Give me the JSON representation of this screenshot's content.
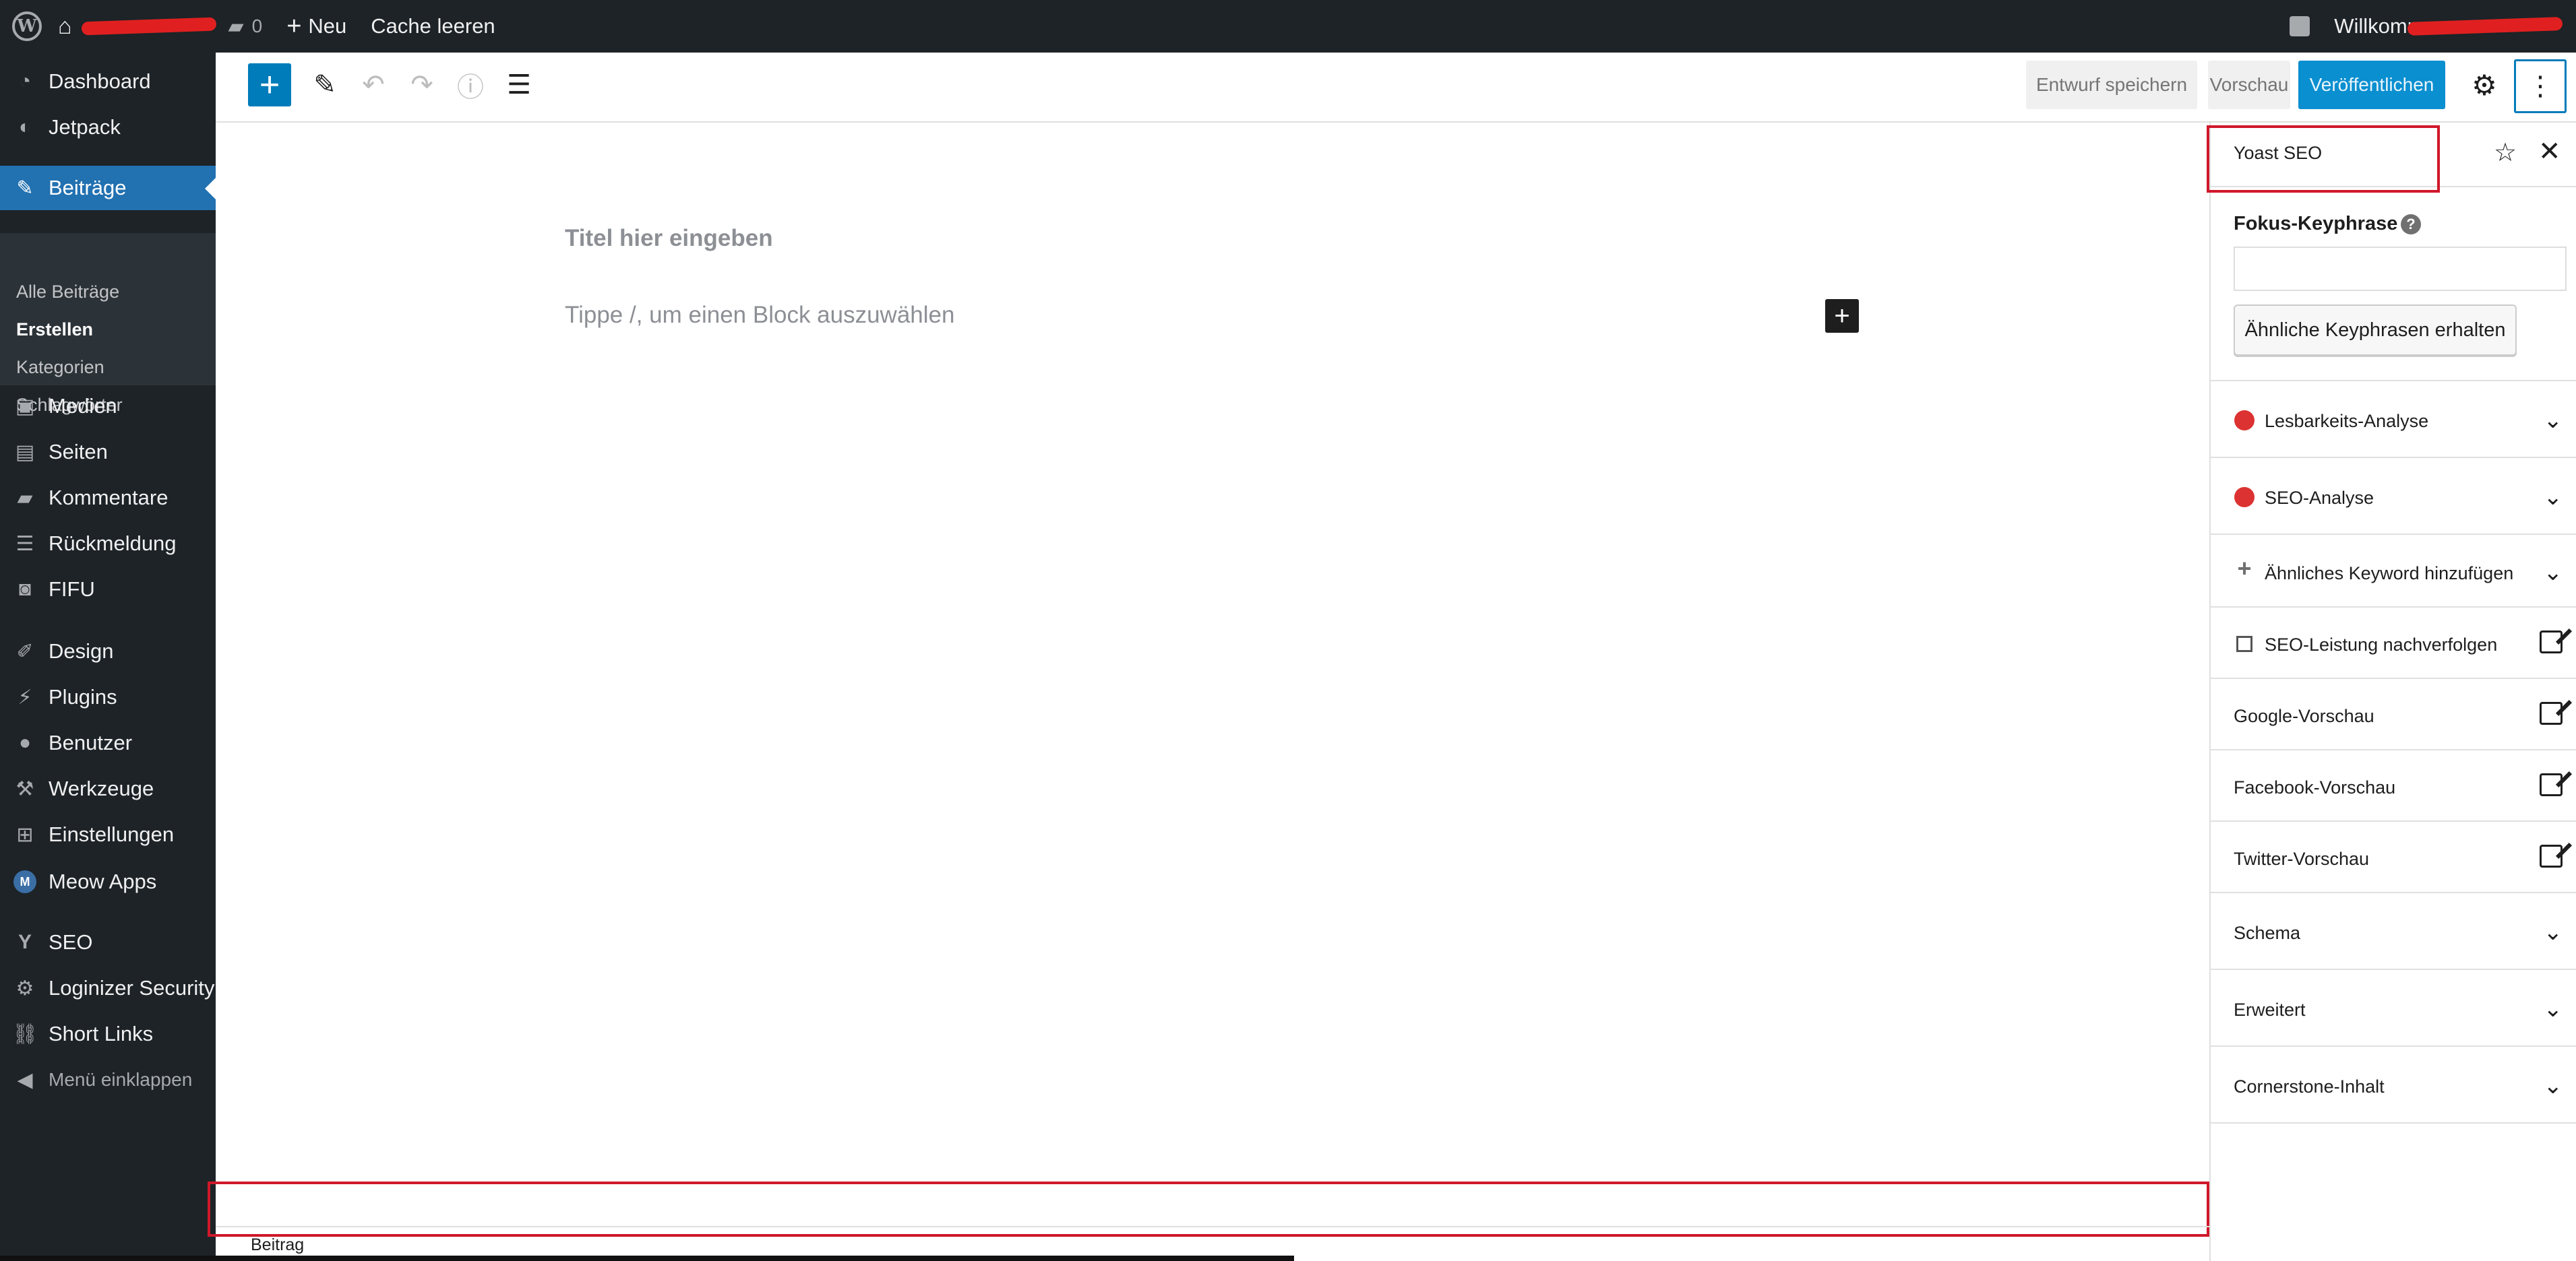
{
  "adminbar": {
    "comments_count": "0",
    "new_label": "Neu",
    "cache_label": "Cache leeren",
    "welcome_label": "Willkommen"
  },
  "menu": {
    "items": [
      {
        "label": "Dashboard",
        "icon": "dashboard-icon"
      },
      {
        "label": "Jetpack",
        "icon": "jetpack-icon"
      },
      {
        "label": "Beiträge",
        "icon": "pin-icon"
      },
      {
        "label": "Medien",
        "icon": "media-icon"
      },
      {
        "label": "Seiten",
        "icon": "pages-icon"
      },
      {
        "label": "Kommentare",
        "icon": "comments-icon"
      },
      {
        "label": "Rückmeldung",
        "icon": "feedback-icon"
      },
      {
        "label": "FIFU",
        "icon": "camera-icon"
      },
      {
        "label": "Design",
        "icon": "brush-icon"
      },
      {
        "label": "Plugins",
        "icon": "plugin-icon"
      },
      {
        "label": "Benutzer",
        "icon": "user-icon"
      },
      {
        "label": "Werkzeuge",
        "icon": "wrench-icon"
      },
      {
        "label": "Einstellungen",
        "icon": "settings-icon"
      },
      {
        "label": "Meow Apps",
        "icon": "meow-icon"
      },
      {
        "label": "SEO",
        "icon": "yoast-icon"
      },
      {
        "label": "Loginizer Security",
        "icon": "gear-icon"
      },
      {
        "label": "Short Links",
        "icon": "link-icon"
      },
      {
        "label": "Menü einklappen",
        "icon": "collapse-icon"
      }
    ],
    "submenu": [
      "Alle Beiträge",
      "Erstellen",
      "Kategorien",
      "Schlagwörter"
    ]
  },
  "header": {
    "draft_label": "Entwurf speichern",
    "preview_label": "Vorschau",
    "publish_label": "Veröffentlichen"
  },
  "canvas": {
    "title_placeholder": "Titel hier eingeben",
    "block_placeholder": "Tippe /, um einen Block auszuwählen"
  },
  "sidebar": {
    "title": "Yoast SEO",
    "focus_label": "Fokus-Keyphrase",
    "focus_value": "",
    "related_button": "Ähnliche Keyphrasen erhalten",
    "panels": [
      "Lesbarkeits-Analyse",
      "SEO-Analyse",
      "Ähnliches Keyword hinzufügen",
      "SEO-Leistung nachverfolgen",
      "Google-Vorschau",
      "Facebook-Vorschau",
      "Twitter-Vorschau",
      "Schema",
      "Erweitert",
      "Cornerstone-Inhalt"
    ],
    "status_color": "#dc3232"
  },
  "footer": {
    "breadcrumb": "Beitrag"
  },
  "colors": {
    "admin_bg": "#1d2327",
    "accent": "#2271b1",
    "publish": "#0a8fd0",
    "annotation": "#d0182a"
  }
}
